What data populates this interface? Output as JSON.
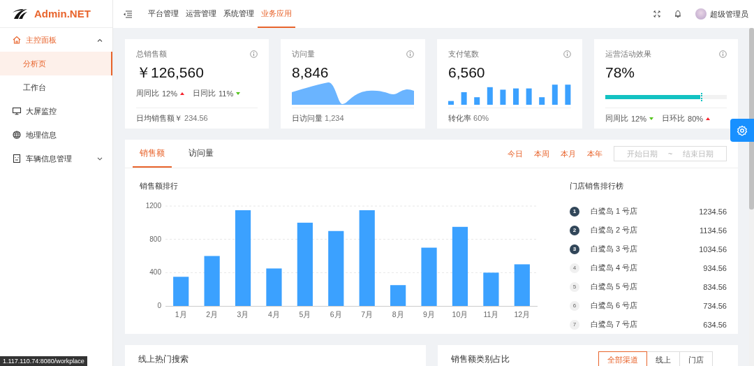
{
  "sidebar": {
    "logo_text": "Admin.NET",
    "items": [
      {
        "label": "主控面板",
        "selected": true,
        "expanded": true,
        "children": [
          {
            "label": "分析页",
            "selected": true
          },
          {
            "label": "工作台",
            "selected": false
          }
        ]
      },
      {
        "label": "大屏监控",
        "selected": false
      },
      {
        "label": "地理信息",
        "selected": false
      },
      {
        "label": "车辆信息管理",
        "selected": false,
        "expanded": false
      }
    ]
  },
  "header": {
    "tabs": [
      {
        "label": "平台管理",
        "selected": false
      },
      {
        "label": "运营管理",
        "selected": false
      },
      {
        "label": "系统管理",
        "selected": false
      },
      {
        "label": "业务应用",
        "selected": true
      }
    ],
    "user": "超级管理员"
  },
  "stats": [
    {
      "kind": "total",
      "title": "总销售额",
      "value": "￥126,560",
      "trends": [
        {
          "label": "周同比",
          "value": "12%",
          "up": true
        },
        {
          "label": "日同比",
          "value": "11%",
          "up": false
        }
      ],
      "footer_label": "日均销售额￥",
      "footer_value": "234.56"
    },
    {
      "kind": "area",
      "title": "访问量",
      "value": "8,846",
      "footer_label": "日访问量",
      "footer_value": "1,234"
    },
    {
      "kind": "bars",
      "title": "支付笔数",
      "value": "6,560",
      "footer_label": "转化率",
      "footer_value": "60%"
    },
    {
      "kind": "progress",
      "title": "运营活动效果",
      "value": "78%",
      "level": 0.78,
      "trends": [
        {
          "label": "同周比",
          "value": "12%",
          "up": false
        },
        {
          "label": "日环比",
          "value": "80%",
          "up": true
        }
      ]
    }
  ],
  "sales": {
    "tabs": [
      {
        "label": "销售额",
        "selected": true
      },
      {
        "label": "访问量",
        "selected": false
      }
    ],
    "ranges": [
      "今日",
      "本周",
      "本月",
      "本年"
    ],
    "date_range": {
      "start_placeholder": "开始日期",
      "separator": "~",
      "end_placeholder": "结束日期"
    },
    "chart_title": "销售额排行",
    "chart_data": {
      "type": "bar",
      "categories": [
        "1月",
        "2月",
        "3月",
        "4月",
        "5月",
        "6月",
        "7月",
        "8月",
        "9月",
        "10月",
        "11月",
        "12月"
      ],
      "series": [
        {
          "color": "#3ba1ff",
          "values": [
            350,
            600,
            1150,
            450,
            1000,
            900,
            1150,
            250,
            700,
            950,
            400,
            500
          ]
        }
      ],
      "ylim": [
        0,
        1200
      ],
      "yticks": [
        0,
        400,
        800,
        1200
      ]
    },
    "ranking": {
      "title": "门店销售排行榜",
      "items": [
        {
          "rank": "1",
          "name": "白鹭岛 1 号店",
          "value": "1234.56",
          "highlighted": true
        },
        {
          "rank": "2",
          "name": "白鹭岛 2 号店",
          "value": "1134.56",
          "highlighted": true
        },
        {
          "rank": "3",
          "name": "白鹭岛 3 号店",
          "value": "1034.56",
          "highlighted": true
        },
        {
          "rank": "4",
          "name": "白鹭岛 4 号店",
          "value": "934.56",
          "highlighted": false
        },
        {
          "rank": "5",
          "name": "白鹭岛 5 号店",
          "value": "834.56",
          "highlighted": false
        },
        {
          "rank": "6",
          "name": "白鹭岛 6 号店",
          "value": "734.56",
          "highlighted": false
        },
        {
          "rank": "7",
          "name": "白鹭岛 7 号店",
          "value": "634.56",
          "highlighted": false
        }
      ]
    }
  },
  "bottom_cards": [
    {
      "title": "线上热门搜索"
    },
    {
      "title": "销售额类别占比",
      "buttons": [
        {
          "label": "全部渠道",
          "selected": true
        },
        {
          "label": "线上",
          "selected": false
        },
        {
          "label": "门店",
          "selected": false
        }
      ]
    }
  ],
  "link_preview": "1.117.110.74:8080/workplace"
}
